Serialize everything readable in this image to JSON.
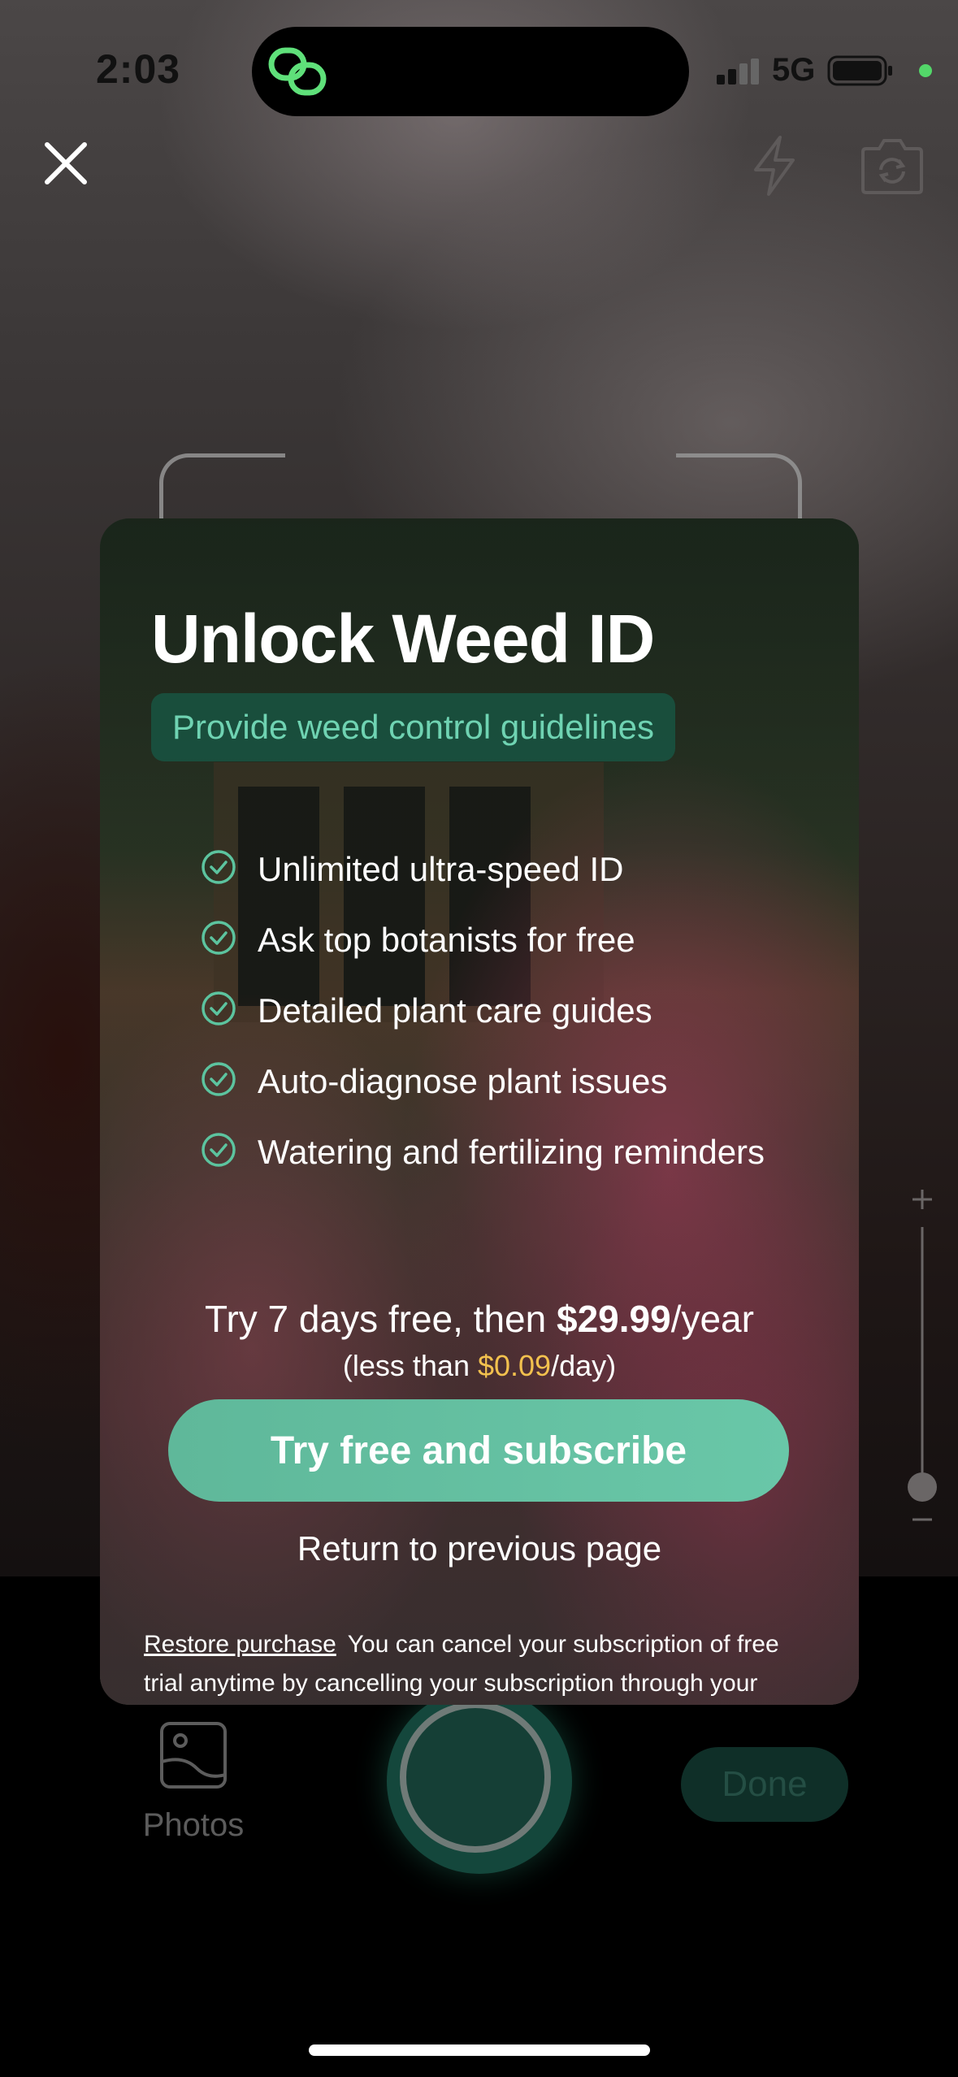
{
  "status_bar": {
    "time": "2:03",
    "network": "5G"
  },
  "camera": {
    "photos_label": "Photos",
    "done_label": "Done"
  },
  "paywall": {
    "title": "Unlock Weed ID",
    "subtitle": "Provide weed control guidelines",
    "features": [
      "Unlimited ultra-speed ID",
      "Ask top botanists for free",
      "Detailed plant care guides",
      "Auto-diagnose plant issues",
      "Watering and fertilizing reminders"
    ],
    "price": {
      "prefix": "Try 7 days free, then ",
      "amount": "$29.99",
      "period": "/year",
      "daily_prefix": "(less than ",
      "daily_amount": "$0.09",
      "daily_suffix": "/day)"
    },
    "cta_label": "Try free and subscribe",
    "return_label": "Return to previous page",
    "restore_label": "Restore purchase",
    "fine_print": "You can cancel your subscription of free trial anytime by cancelling your subscription through your"
  },
  "colors": {
    "accent_green": "#69c7a8",
    "subtitle_green": "#6fd3b2",
    "price_highlight": "#f2c14e"
  },
  "icons": [
    "close-icon",
    "flash-icon",
    "flip-camera-icon",
    "check-circle-icon",
    "photos-icon",
    "zoom-plus-icon",
    "zoom-minus-icon",
    "app-link-icon"
  ]
}
